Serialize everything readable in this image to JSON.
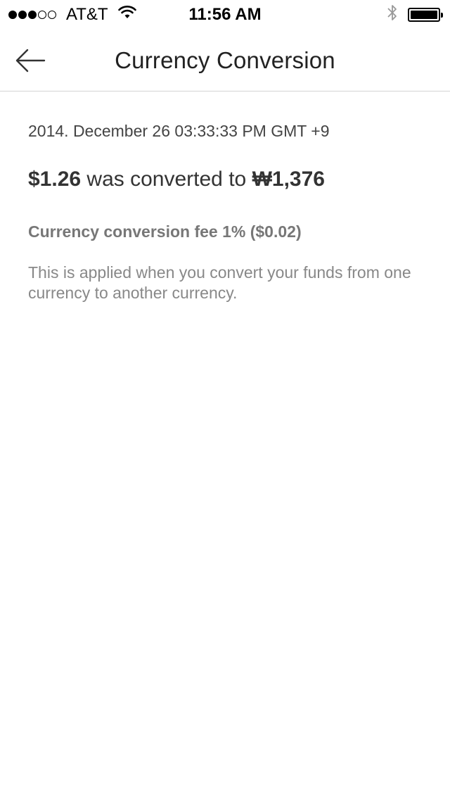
{
  "status_bar": {
    "carrier": "AT&T",
    "time": "11:56 AM",
    "signal_filled": 3,
    "signal_total": 5,
    "icons": [
      "wifi-icon",
      "bluetooth-icon",
      "battery-icon"
    ]
  },
  "nav": {
    "title": "Currency Conversion",
    "back_icon": "back-arrow-icon"
  },
  "conversion": {
    "timestamp": "2014. December 26 03:33:33 PM GMT +9",
    "from_amount": "$1.26",
    "connector": "was converted to",
    "to_amount": "₩1,376",
    "fee_label": "Currency conversion fee 1% ($0.02)",
    "fee_description": "This is applied when you convert your funds from one currency to another currency."
  },
  "colors": {
    "divider": "#d4d4d4",
    "primary_text": "#333333",
    "secondary_text": "#888888"
  }
}
